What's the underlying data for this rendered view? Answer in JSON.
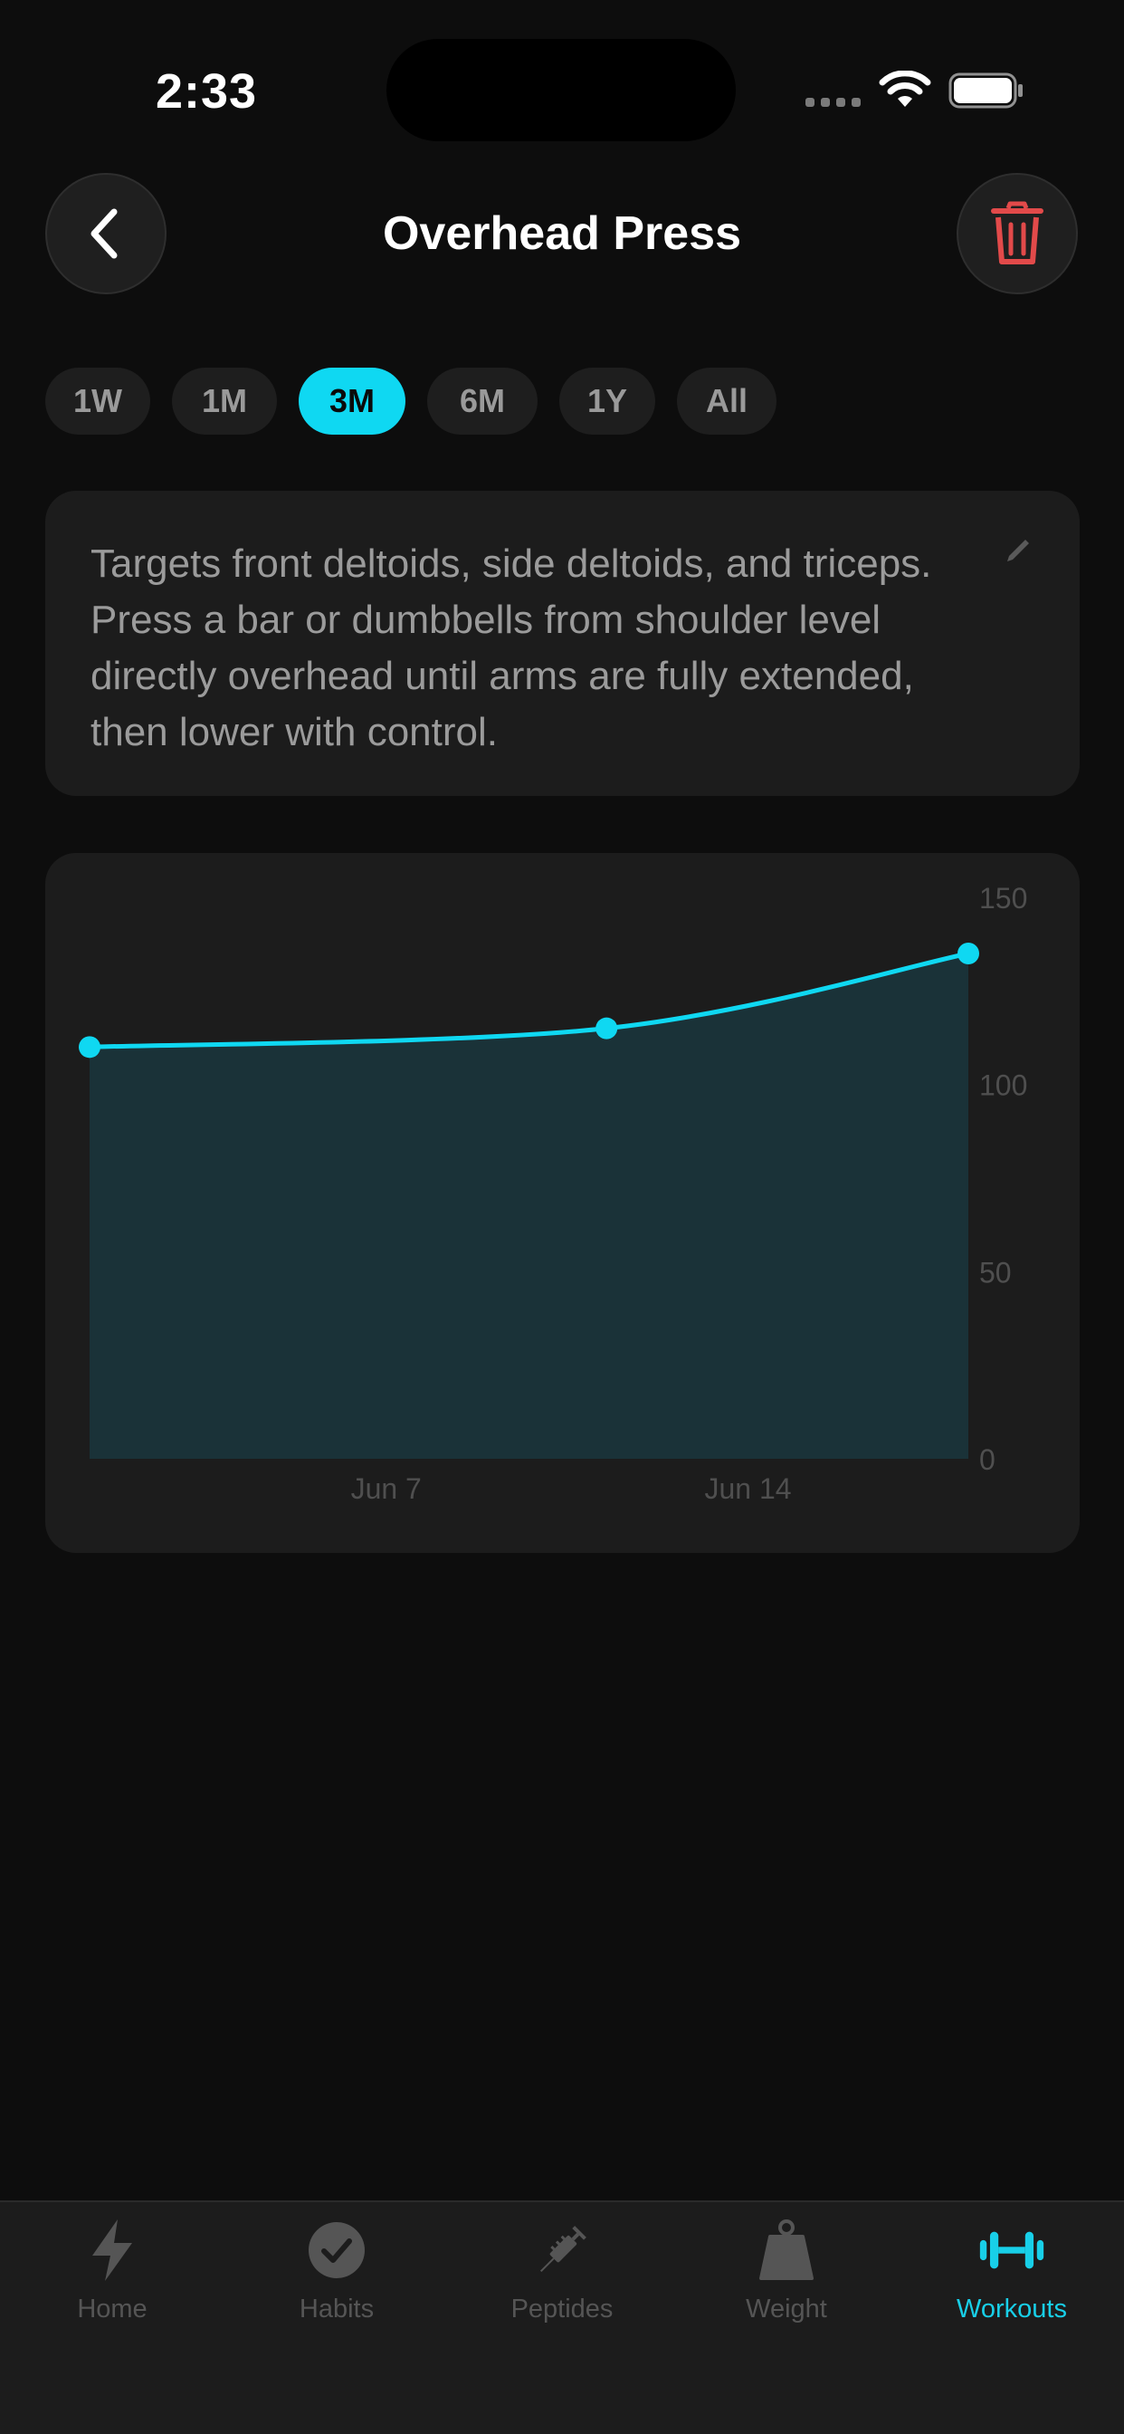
{
  "status_bar": {
    "time": "2:33"
  },
  "header": {
    "title": "Overhead Press"
  },
  "ranges": [
    {
      "label": "1W",
      "active": false
    },
    {
      "label": "1M",
      "active": false
    },
    {
      "label": "3M",
      "active": true
    },
    {
      "label": "6M",
      "active": false
    },
    {
      "label": "1Y",
      "active": false
    },
    {
      "label": "All",
      "active": false
    }
  ],
  "description": "Targets front deltoids, side deltoids, and triceps. Press a bar or dumbbells from shoulder level directly overhead until arms are fully extended, then lower with control.",
  "colors": {
    "accent": "#0fd8f2",
    "danger": "#e24a4a",
    "fill": "#1a3238",
    "background": "#0d0d0d",
    "card": "#1c1c1c"
  },
  "chart_data": {
    "type": "area",
    "x": [
      "Jun 1",
      "Jun 11",
      "Jun 18"
    ],
    "xticks": [
      "Jun 7",
      "Jun 14"
    ],
    "series": [
      {
        "values": [
          110,
          115,
          135
        ]
      }
    ],
    "ylim": [
      0,
      150
    ],
    "yticks": [
      0,
      50,
      100,
      150
    ],
    "grid": false
  },
  "tabs": [
    {
      "label": "Home",
      "icon": "bolt-icon",
      "active": false
    },
    {
      "label": "Habits",
      "icon": "check-circle-icon",
      "active": false
    },
    {
      "label": "Peptides",
      "icon": "syringe-icon",
      "active": false
    },
    {
      "label": "Weight",
      "icon": "kettlebell-weight-icon",
      "active": false
    },
    {
      "label": "Workouts",
      "icon": "dumbbell-icon",
      "active": true
    }
  ]
}
